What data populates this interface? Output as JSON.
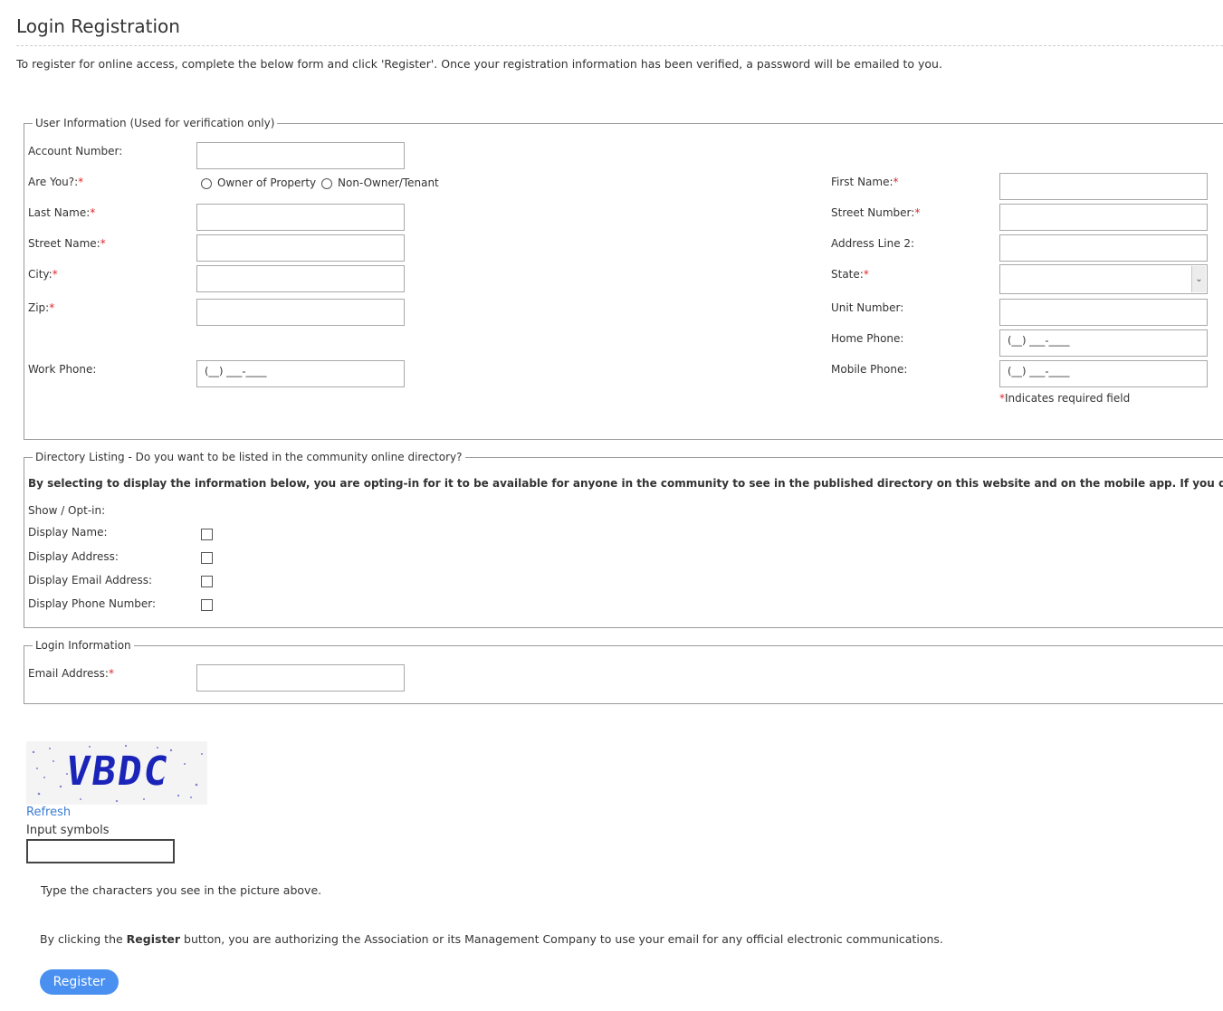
{
  "page": {
    "title": "Login Registration",
    "intro": "To register for online access, complete the below form and click 'Register'. Once your registration information has been verified, a password will be emailed to you."
  },
  "user_info": {
    "legend": "User Information (Used for verification only)",
    "account_number_label": "Account Number:",
    "are_you_label": "Are You?:",
    "radio_owner": "Owner of Property",
    "radio_tenant": "Non-Owner/Tenant",
    "first_name_label": "First Name:",
    "last_name_label": "Last Name:",
    "street_number_label": "Street Number:",
    "street_name_label": "Street Name:",
    "address_line2_label": "Address Line 2:",
    "city_label": "City:",
    "state_label": "State:",
    "zip_label": "Zip:",
    "unit_number_label": "Unit Number:",
    "home_phone_label": "Home Phone:",
    "work_phone_label": "Work Phone:",
    "mobile_phone_label": "Mobile Phone:",
    "phone_mask": "(__) ___-____",
    "required_star": "*",
    "required_note": "Indicates required field"
  },
  "directory": {
    "legend": "Directory Listing - Do you want to be listed in the community online directory?",
    "notice": "By selecting to display the information below, you are opting-in for it to be available for anyone in the community to see in the published directory on this website and on the mobile app. If you do not wish to share your in",
    "show_optin": "Show / Opt-in:",
    "display_name": "Display Name:",
    "display_address": "Display Address:",
    "display_email": "Display Email Address:",
    "display_phone": "Display Phone Number:"
  },
  "login": {
    "legend": "Login Information",
    "email_label": "Email Address:"
  },
  "captcha": {
    "image_text": "VBDC",
    "refresh": "Refresh",
    "input_label": "Input symbols",
    "instruction": "Type the characters you see in the picture above."
  },
  "footer": {
    "consent_prefix": "By clicking the ",
    "consent_bold": "Register",
    "consent_suffix": " button, you are authorizing the Association or its Management Company to use your email for any official electronic communications.",
    "register_button": "Register"
  },
  "colors": {
    "accent": "#4a90f0",
    "required": "#e0262b",
    "link": "#3a7bd5",
    "captcha_glyph": "#1b24b8"
  }
}
